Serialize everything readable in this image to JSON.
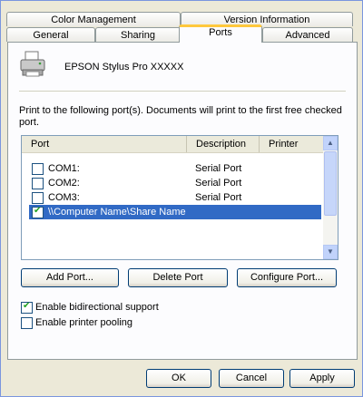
{
  "tabs_row1": [
    {
      "label": "Color Management"
    },
    {
      "label": "Version Information"
    }
  ],
  "tabs_row2": [
    {
      "label": "General"
    },
    {
      "label": "Sharing"
    },
    {
      "label": "Ports",
      "active": true
    },
    {
      "label": "Advanced"
    }
  ],
  "printer": {
    "name": "EPSON Stylus Pro XXXXX",
    "icon": "printer-icon"
  },
  "description": "Print to the following port(s). Documents will print to the first free checked port.",
  "ports_table": {
    "columns": [
      "Port",
      "Description",
      "Printer"
    ],
    "rows": [
      {
        "port": "COM1:",
        "description": "Serial Port",
        "checked": false,
        "selected": false
      },
      {
        "port": "COM2:",
        "description": "Serial Port",
        "checked": false,
        "selected": false
      },
      {
        "port": "COM3:",
        "description": "Serial Port",
        "checked": false,
        "selected": false
      },
      {
        "port": "\\\\Computer Name\\Share Name",
        "description": "",
        "checked": true,
        "selected": true
      }
    ]
  },
  "port_buttons": {
    "add": "Add Port...",
    "delete": "Delete Port",
    "configure": "Configure Port..."
  },
  "options": {
    "bidirectional": {
      "label": "Enable bidirectional support",
      "checked": true
    },
    "pooling": {
      "label": "Enable printer pooling",
      "checked": false
    }
  },
  "dialog_buttons": {
    "ok": "OK",
    "cancel": "Cancel",
    "apply": "Apply"
  },
  "colors": {
    "selection": "#316ac5",
    "active_tab_accent": "#ffc83c",
    "dialog_bg": "#ece9d8"
  }
}
